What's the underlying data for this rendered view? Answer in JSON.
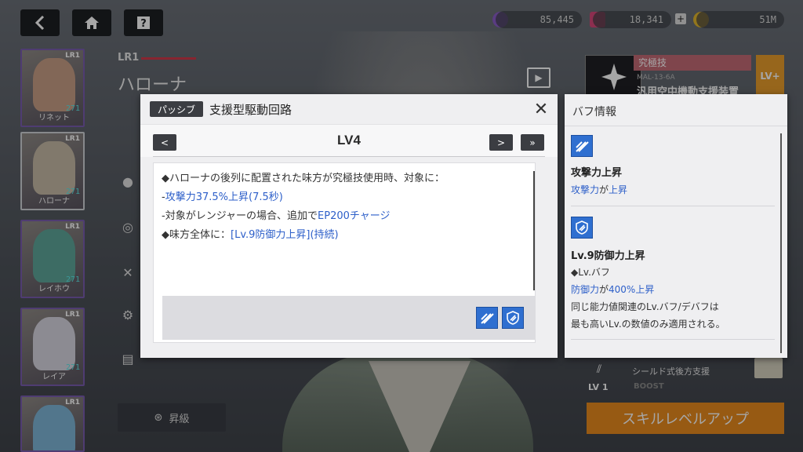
{
  "resources": {
    "gems": "85,445",
    "tickets": "18,341",
    "credits": "51M",
    "plus": "+"
  },
  "roster": [
    {
      "name": "リネット",
      "level": "271",
      "rank": "LR1",
      "color": "#c89e86"
    },
    {
      "name": "ハローナ",
      "level": "271",
      "rank": "LR1",
      "color": "#c7bba7"
    },
    {
      "name": "レイホウ",
      "level": "271",
      "rank": "LR1",
      "color": "#5fa79a"
    },
    {
      "name": "レイア",
      "level": "271",
      "rank": "LR1",
      "color": "#d8d6e0"
    },
    {
      "name": "",
      "level": "",
      "rank": "LR1",
      "color": "#7fb6d8"
    }
  ],
  "character": {
    "rank_tag": "LR1",
    "name": "ハローナ"
  },
  "ultimate": {
    "label": "究極技",
    "code": "MAL-13-6A",
    "name": "汎用空中機動支援装置",
    "lvplus": "LV+"
  },
  "passive_skill_behind": {
    "name": "シールド式後方支援",
    "level": "LV 1",
    "boost": "BOOST"
  },
  "buttons": {
    "ascend": "昇級",
    "skill_level_up": "スキルレベルアップ"
  },
  "popup": {
    "tag": "パッシブ",
    "title": "支援型駆動回路",
    "level": "LV4",
    "prev_label": "<",
    "next_label": ">",
    "max_label": "»",
    "close_label": "✕",
    "lines": [
      {
        "parts": [
          {
            "text": "◆ハローナの後列に配置された味方が究極技使用時、対象に：",
            "blue": false
          }
        ]
      },
      {
        "parts": [
          {
            "text": "-",
            "blue": false
          },
          {
            "text": "攻撃力37.5%上昇(7.5秒)",
            "blue": true
          }
        ]
      },
      {
        "parts": [
          {
            "text": "-対象がレンジャーの場合、追加で",
            "blue": false
          },
          {
            "text": "EP200チャージ",
            "blue": true
          }
        ]
      },
      {
        "parts": [
          {
            "text": "◆味方全体に：",
            "blue": false
          },
          {
            "text": "[Lv.9防御力上昇](持続)",
            "blue": true
          }
        ]
      }
    ]
  },
  "info": {
    "title": "バフ情報",
    "buffs": [
      {
        "icon": "attack-up-icon",
        "name": "攻撃力上昇",
        "lines": [
          [
            {
              "text": "攻撃力",
              "blue": true
            },
            {
              "text": "が",
              "blue": false
            },
            {
              "text": "上昇",
              "blue": true
            }
          ]
        ]
      },
      {
        "icon": "defense-up-icon",
        "name": "Lv.9防御力上昇",
        "lines": [
          [
            {
              "text": "◆Lv.バフ",
              "blue": false
            }
          ],
          [
            {
              "text": "防御力",
              "blue": true
            },
            {
              "text": "が",
              "blue": false
            },
            {
              "text": "400%上昇",
              "blue": true
            }
          ],
          [
            {
              "text": "同じ能力値関連のLv.バフ/デバフは",
              "blue": false
            }
          ],
          [
            {
              "text": "最も高いLv.の数値のみ適用される。",
              "blue": false
            }
          ]
        ]
      }
    ]
  },
  "colors": {
    "accent_blue": "#2d5fc9",
    "buff_icon": "#2f6fd0",
    "orange": "#e88a1e"
  }
}
